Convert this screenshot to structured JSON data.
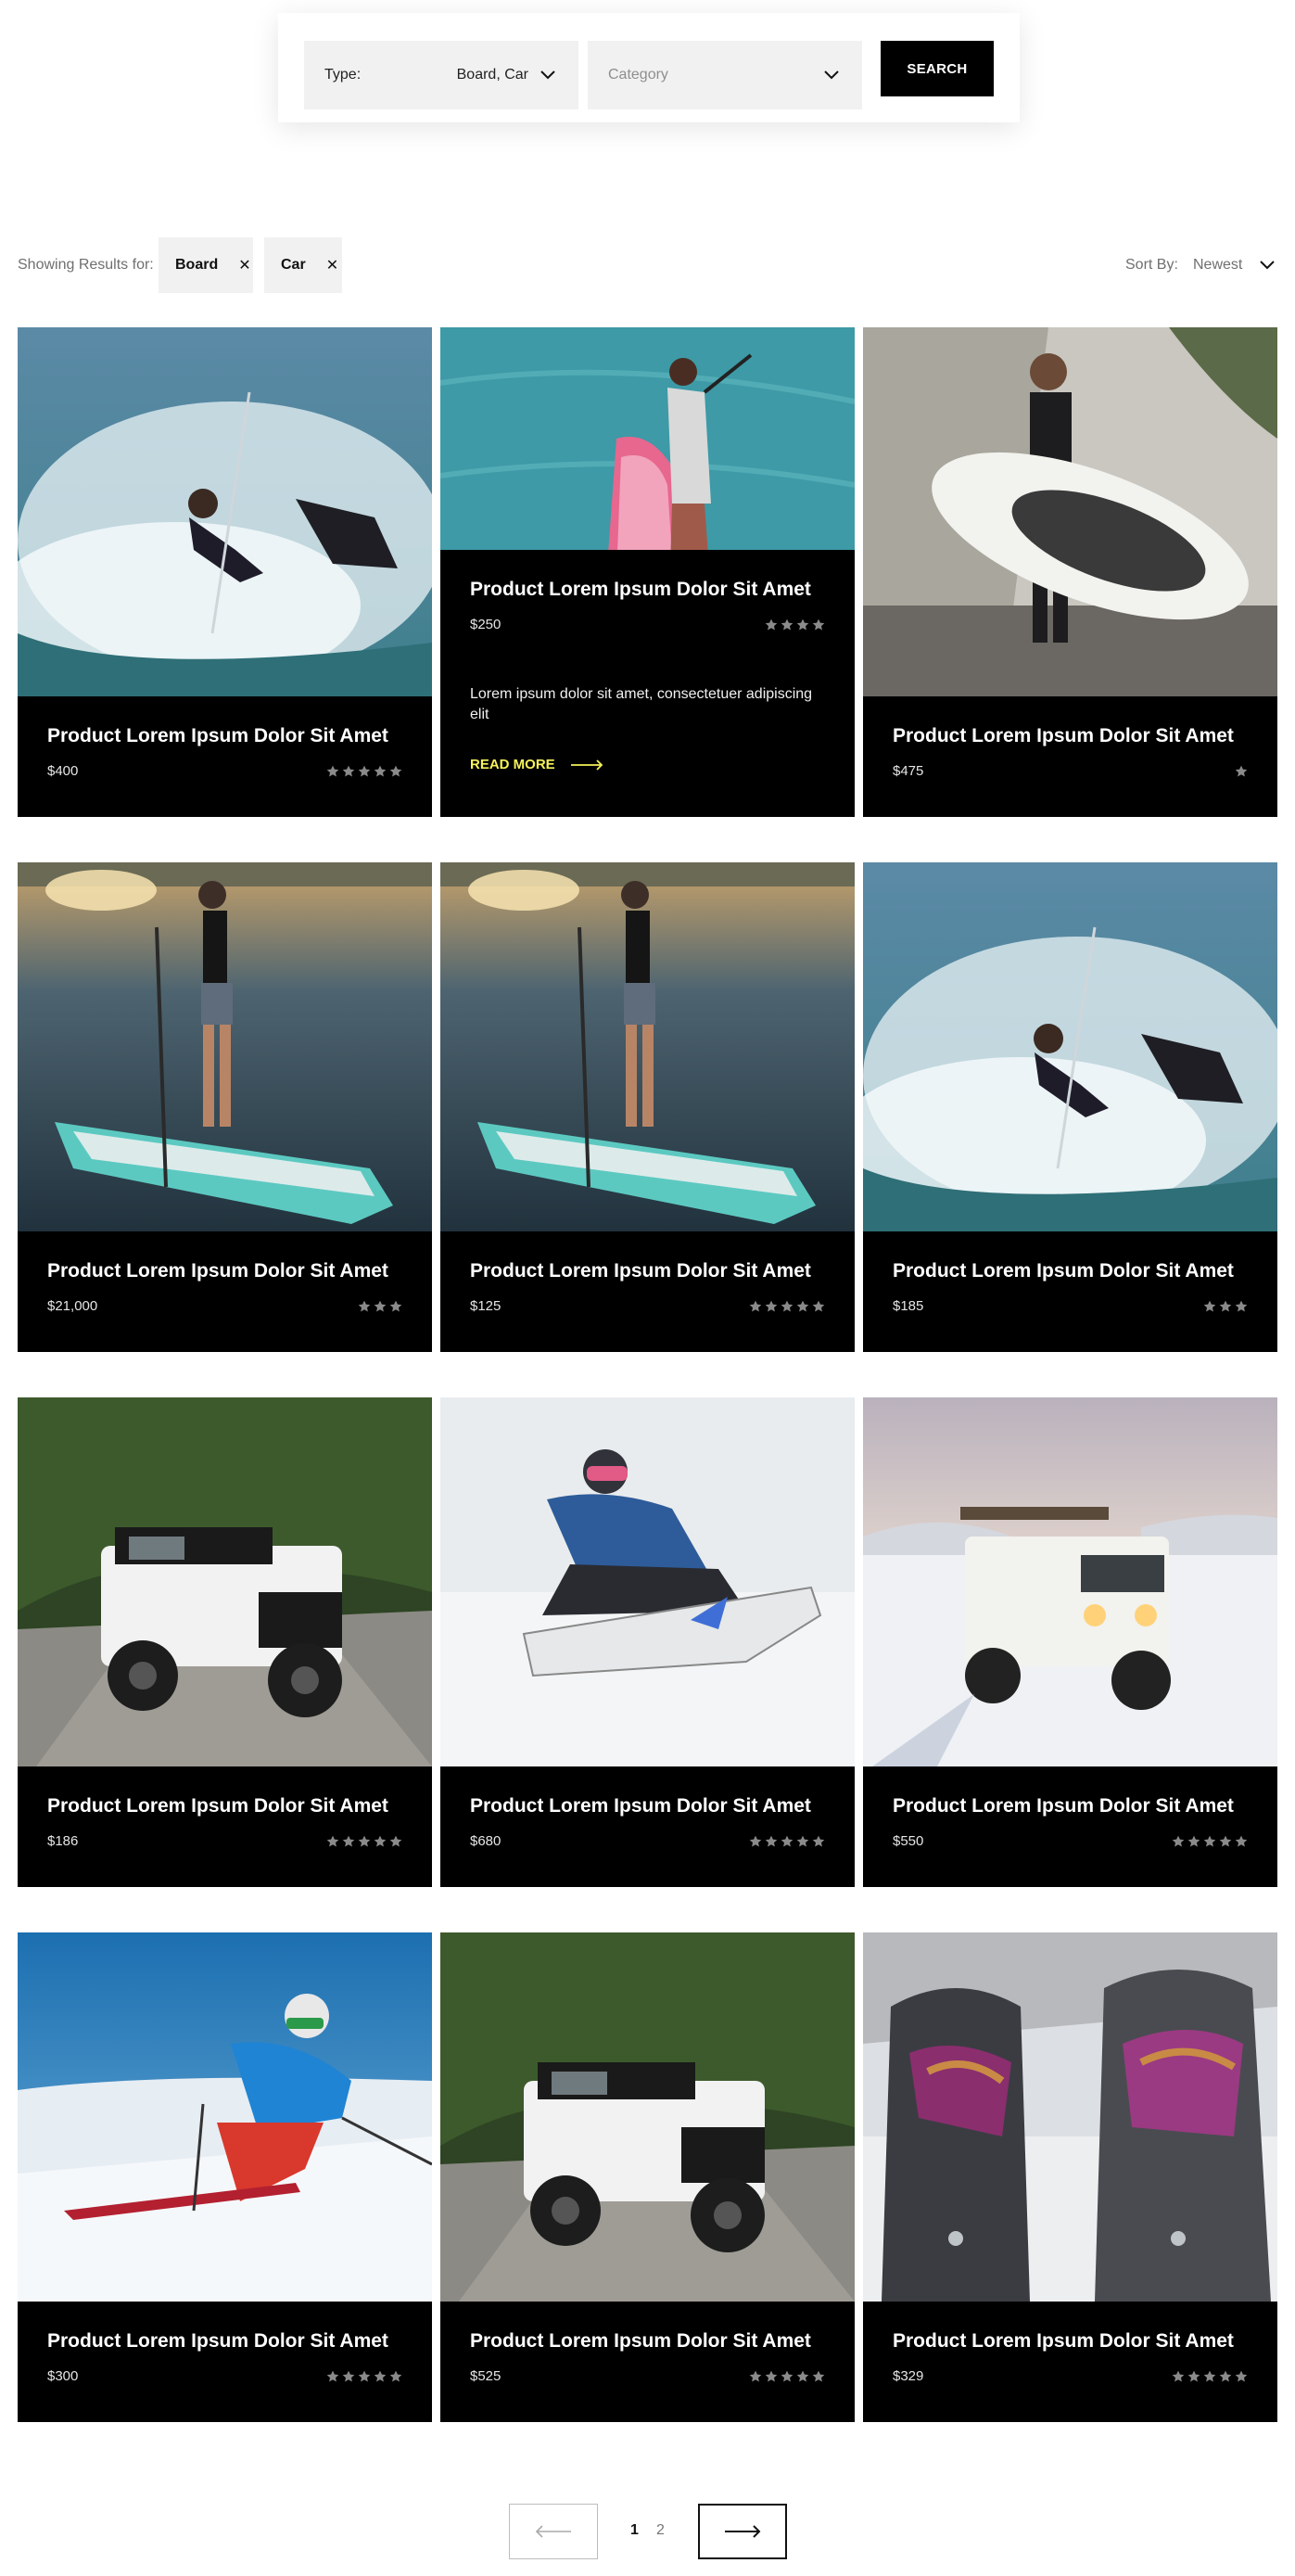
{
  "search": {
    "type_label": "Type:",
    "type_value": "Board, Car",
    "category_placeholder": "Category",
    "button_label": "SEARCH"
  },
  "results": {
    "label": "Showing Results for:",
    "filters": [
      {
        "label": "Board",
        "remove_icon": "close-icon"
      },
      {
        "label": "Car",
        "remove_icon": "close-icon"
      }
    ],
    "sort_label": "Sort By:",
    "sort_value": "Newest"
  },
  "products": [
    {
      "title": "Product Lorem Ipsum Dolor Sit Amet",
      "price": "$400",
      "stars": 5,
      "image": "kitesurfer"
    },
    {
      "title": "Product Lorem Ipsum Dolor Sit Amet",
      "price": "$250",
      "stars": 4,
      "image": "paddleboard-aerial",
      "expanded": true,
      "description": "Lorem ipsum dolor sit amet, consectetuer adipiscing elit",
      "read_more": "READ MORE"
    },
    {
      "title": "Product Lorem Ipsum Dolor Sit Amet",
      "price": "$475",
      "stars": 1,
      "image": "man-with-board"
    },
    {
      "title": "Product Lorem Ipsum Dolor Sit Amet",
      "price": "$21,000",
      "stars": 3,
      "image": "paddleboard-sunset"
    },
    {
      "title": "Product Lorem Ipsum Dolor Sit Amet",
      "price": "$125",
      "stars": 5,
      "image": "paddleboard-sunset"
    },
    {
      "title": "Product Lorem Ipsum Dolor Sit Amet",
      "price": "$185",
      "stars": 3,
      "image": "kitesurfer"
    },
    {
      "title": "Product Lorem Ipsum Dolor Sit Amet",
      "price": "$186",
      "stars": 5,
      "image": "jeep-forest"
    },
    {
      "title": "Product Lorem Ipsum Dolor Sit Amet",
      "price": "$680",
      "stars": 5,
      "image": "snowboarder"
    },
    {
      "title": "Product Lorem Ipsum Dolor Sit Amet",
      "price": "$550",
      "stars": 5,
      "image": "defender-snow"
    },
    {
      "title": "Product Lorem Ipsum Dolor Sit Amet",
      "price": "$300",
      "stars": 5,
      "image": "skier"
    },
    {
      "title": "Product Lorem Ipsum Dolor Sit Amet",
      "price": "$525",
      "stars": 5,
      "image": "jeep-forest"
    },
    {
      "title": "Product Lorem Ipsum Dolor Sit Amet",
      "price": "$329",
      "stars": 5,
      "image": "snowshoes"
    }
  ],
  "pagination": {
    "prev_icon": "arrow-left-icon",
    "pages": [
      "1",
      "2"
    ],
    "current": "1",
    "next_icon": "arrow-right-icon"
  },
  "colors": {
    "card_background": "#000000",
    "read_more": "#f5f25a",
    "star": "#8a8a8a",
    "field_background": "#f1f1f1"
  }
}
